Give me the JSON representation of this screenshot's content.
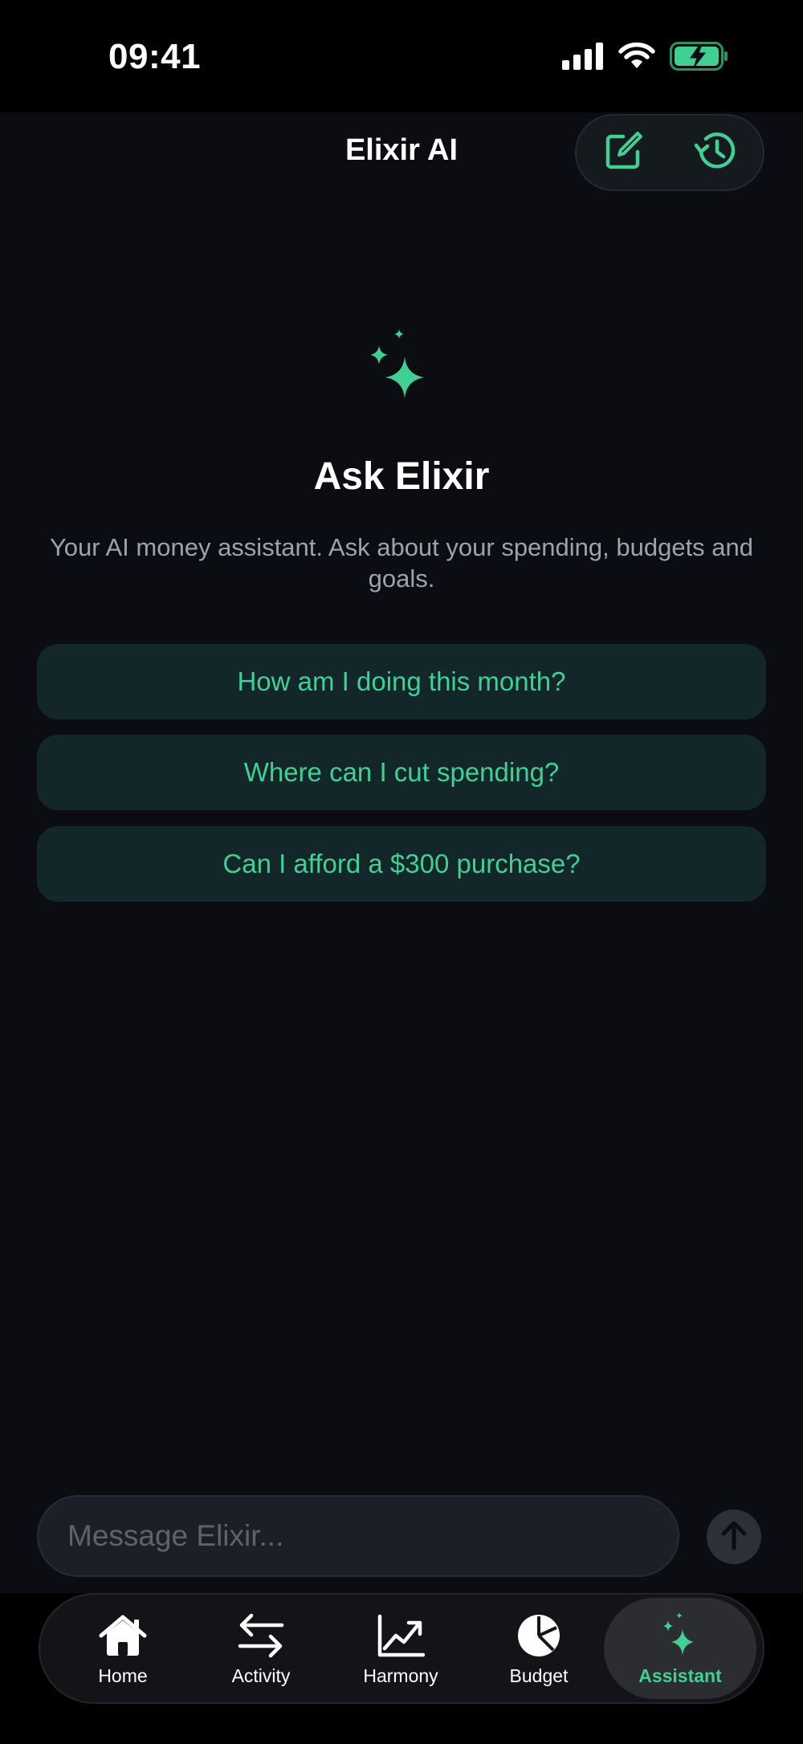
{
  "status_bar": {
    "time": "09:41"
  },
  "header": {
    "title": "Elixir AI",
    "new_chat_icon": "compose-icon",
    "history_icon": "history-icon"
  },
  "hero": {
    "icon": "sparkles-icon",
    "title": "Ask Elixir",
    "subtitle": "Your AI money assistant. Ask about your spending, budgets and goals."
  },
  "suggestions": [
    {
      "label": "How am I doing this month?"
    },
    {
      "label": "Where can I cut spending?"
    },
    {
      "label": "Can I afford a $300 purchase?"
    }
  ],
  "composer": {
    "placeholder": "Message Elixir...",
    "send_icon": "arrow-up-icon"
  },
  "tabs": [
    {
      "label": "Home",
      "icon": "house-icon"
    },
    {
      "label": "Activity",
      "icon": "arrows-left-right-icon"
    },
    {
      "label": "Harmony",
      "icon": "chart-line-icon"
    },
    {
      "label": "Budget",
      "icon": "pie-chart-icon"
    },
    {
      "label": "Assistant",
      "icon": "sparkles-icon",
      "active": true
    }
  ],
  "colors": {
    "accent": "#3fd193",
    "background": "#0b0d13",
    "suggestion_bg": "#13272a"
  }
}
